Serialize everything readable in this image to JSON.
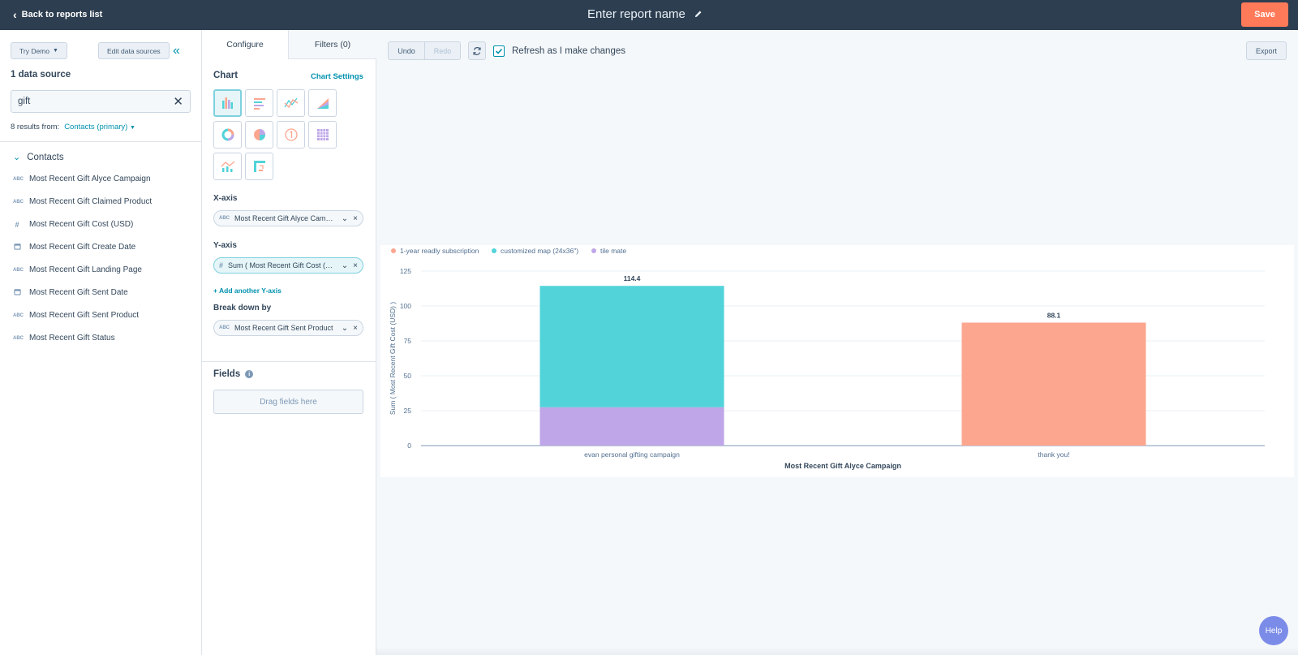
{
  "topbar": {
    "back_label": "Back to reports list",
    "report_name_placeholder": "Enter report name",
    "save_label": "Save"
  },
  "left": {
    "try_demo": "Try Demo",
    "edit_sources": "Edit data sources",
    "data_source_count": "1 data source",
    "search_value": "gift",
    "results_prefix": "8 results from:",
    "results_source": "Contacts (primary)",
    "group_label": "Contacts",
    "properties": [
      {
        "type": "ABC",
        "label": "Most Recent Gift Alyce Campaign"
      },
      {
        "type": "ABC",
        "label": "Most Recent Gift Claimed Product"
      },
      {
        "type": "#",
        "label": "Most Recent Gift Cost (USD)"
      },
      {
        "type": "cal",
        "label": "Most Recent Gift Create Date"
      },
      {
        "type": "ABC",
        "label": "Most Recent Gift Landing Page"
      },
      {
        "type": "cal",
        "label": "Most Recent Gift Sent Date"
      },
      {
        "type": "ABC",
        "label": "Most Recent Gift Sent Product"
      },
      {
        "type": "ABC",
        "label": "Most Recent Gift Status"
      }
    ]
  },
  "config": {
    "tab_configure": "Configure",
    "tab_filters": "Filters (0)",
    "chart_label": "Chart",
    "chart_settings": "Chart Settings",
    "xaxis_label": "X-axis",
    "xaxis_value": "Most Recent Gift Alyce Campaign",
    "yaxis_label": "Y-axis",
    "yaxis_value": "Sum ( Most Recent Gift Cost (USD) )",
    "add_yaxis": "+ Add another Y-axis",
    "breakdown_label": "Break down by",
    "breakdown_value": "Most Recent Gift Sent Product",
    "fields_label": "Fields",
    "drop_hint": "Drag fields here"
  },
  "toolbar": {
    "undo": "Undo",
    "redo": "Redo",
    "refresh_label": "Refresh as I make changes",
    "export": "Export"
  },
  "help_label": "Help",
  "chart_data": {
    "type": "bar",
    "stacked": true,
    "categories": [
      "evan personal gifting campaign",
      "thank you!"
    ],
    "series": [
      {
        "name": "1-year readly subscription",
        "color": "#fca68f",
        "values": [
          0,
          88.1
        ]
      },
      {
        "name": "customized map (24x36\")",
        "color": "#51d3d9",
        "values": [
          86.9,
          0
        ]
      },
      {
        "name": "tile mate",
        "color": "#bea6e8",
        "values": [
          27.5,
          0
        ]
      }
    ],
    "totals": [
      "114.4",
      "88.1"
    ],
    "xlabel": "Most Recent Gift Alyce Campaign",
    "ylabel": "Sum ( Most Recent Gift Cost (USD) )",
    "yticks": [
      "0",
      "25",
      "50",
      "75",
      "100",
      "125"
    ],
    "ylim": [
      0,
      125
    ],
    "grid": true,
    "legend_position": "top-left"
  }
}
